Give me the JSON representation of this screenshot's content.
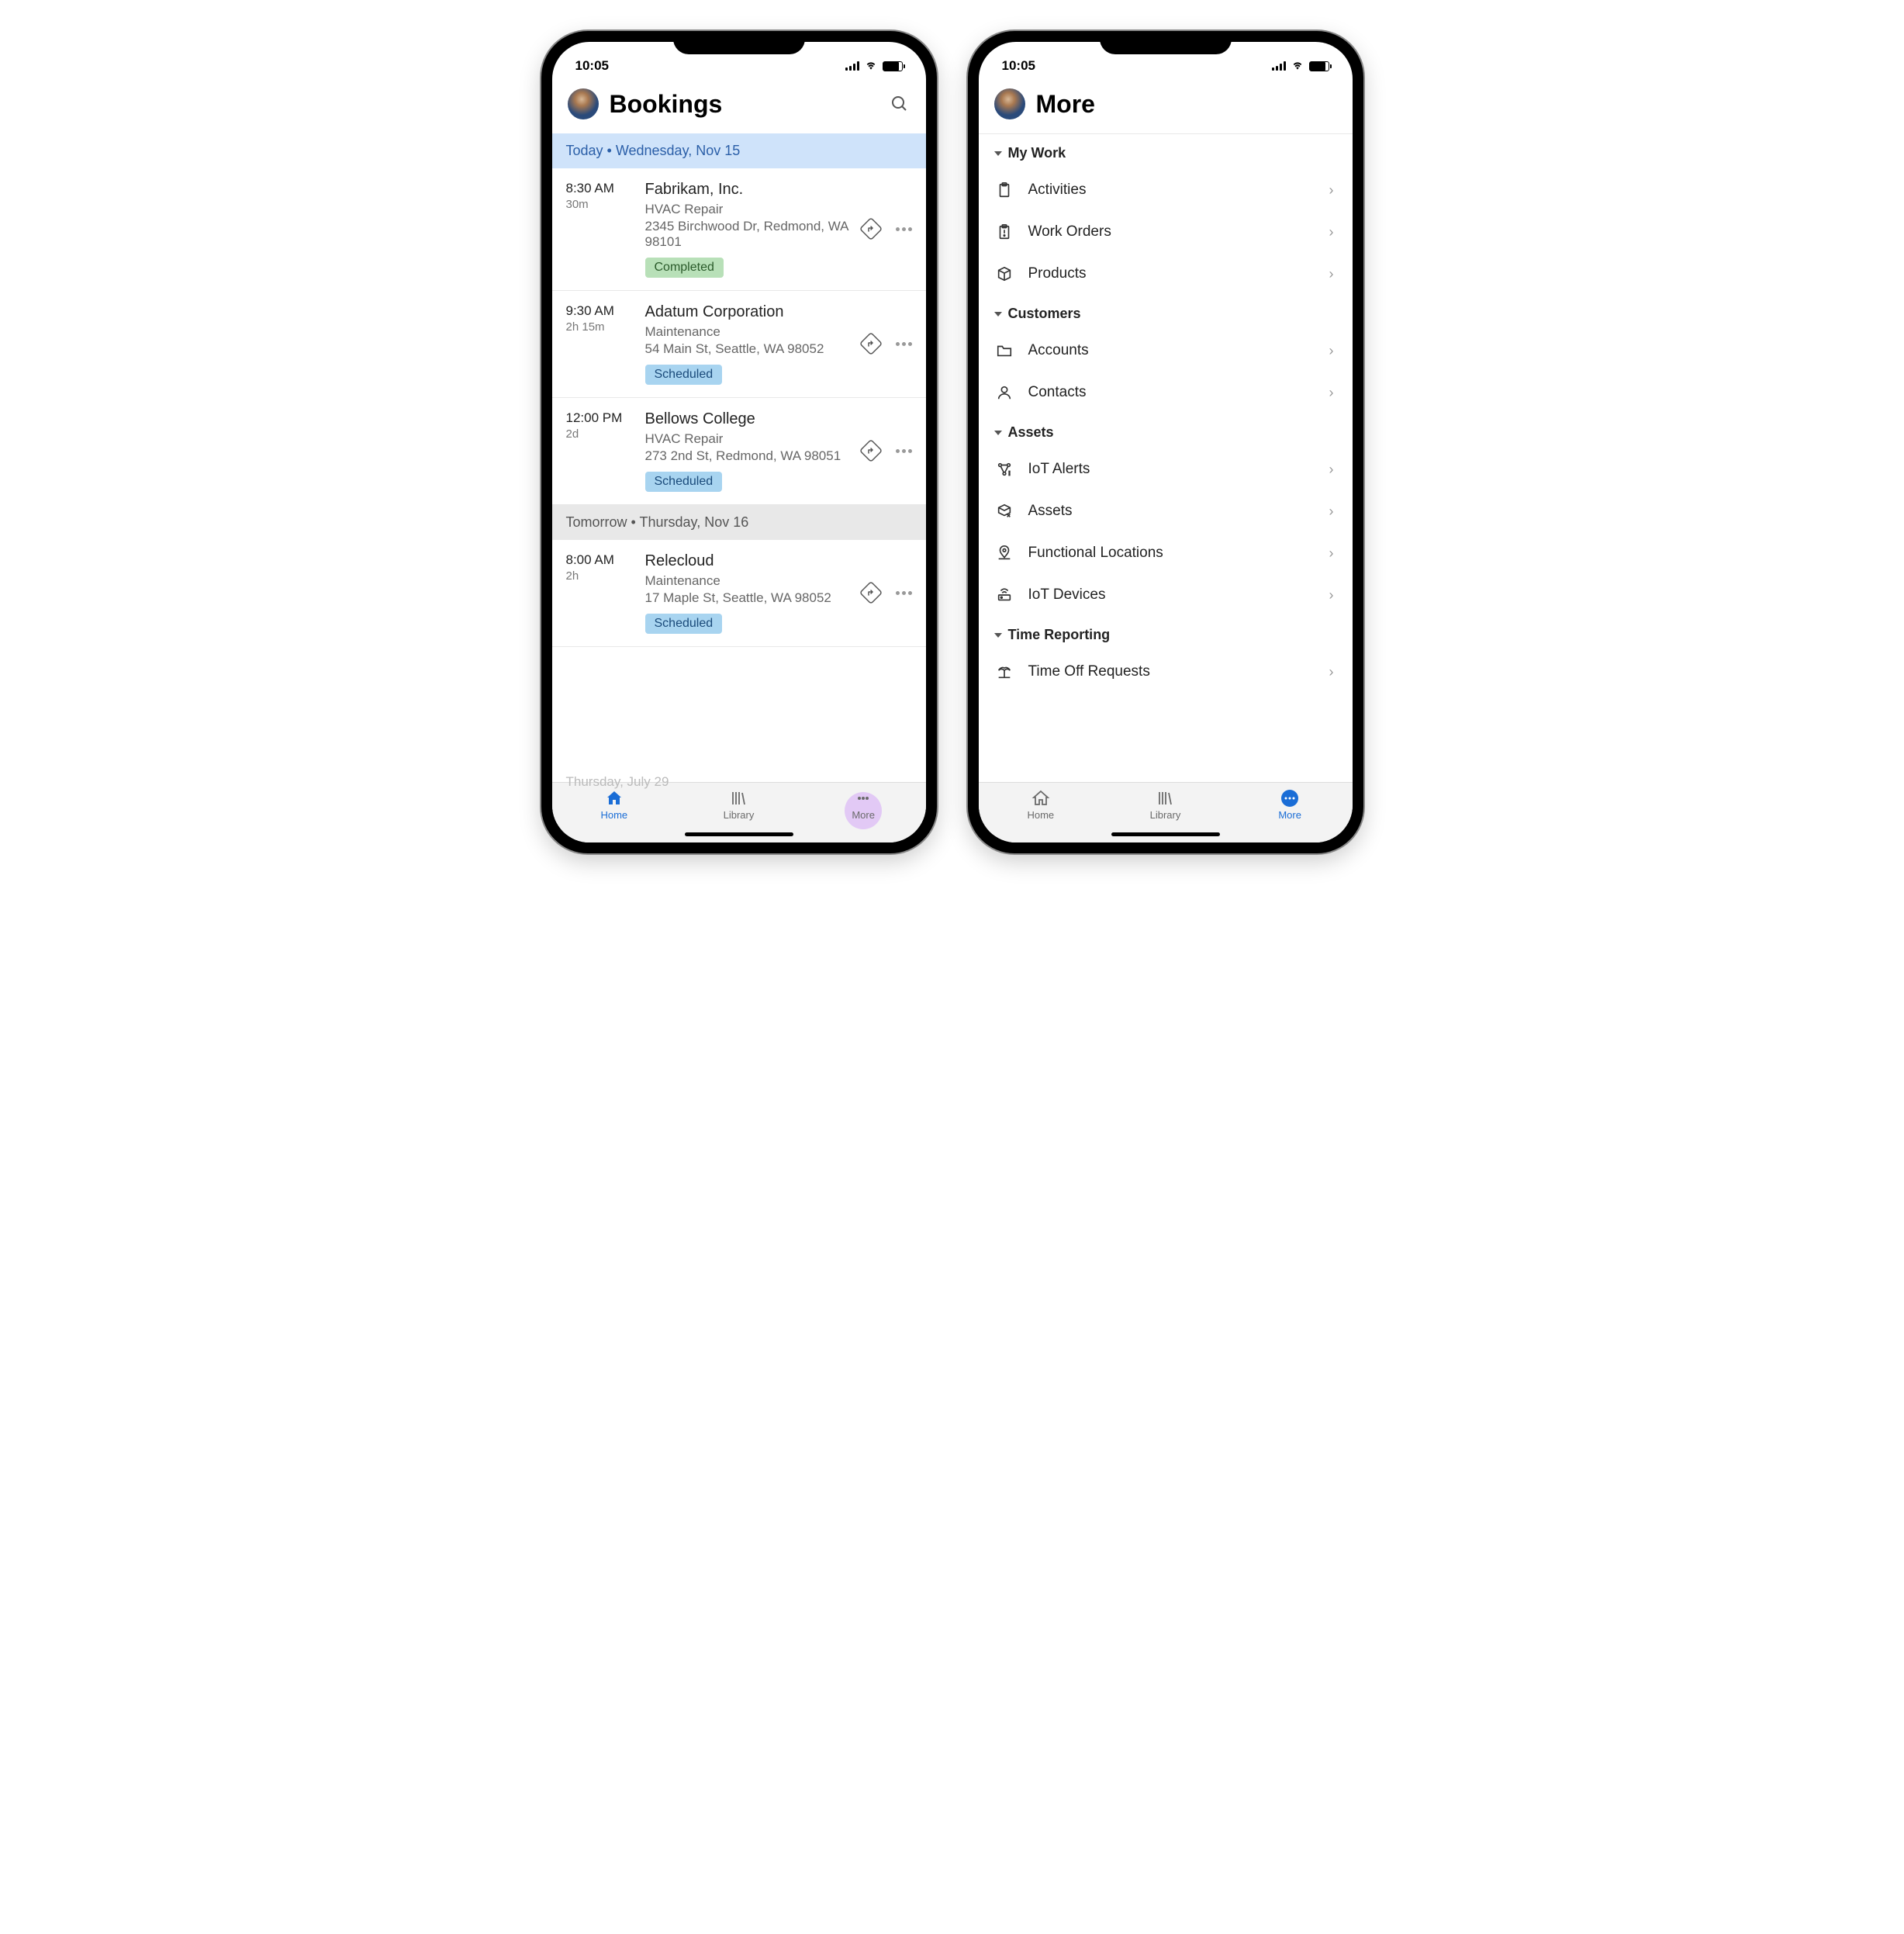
{
  "status_bar": {
    "time": "10:05"
  },
  "left_phone": {
    "title": "Bookings",
    "faded_date": "Thursday, July 29",
    "groups": [
      {
        "label": "Today  •  Wednesday, Nov 15",
        "style": "primary",
        "items": [
          {
            "start": "8:30 AM",
            "duration": "30m",
            "customer": "Fabrikam, Inc.",
            "service": "HVAC Repair",
            "address": "2345 Birchwood Dr, Redmond, WA 98101",
            "status": "Completed",
            "status_class": "completed"
          },
          {
            "start": "9:30 AM",
            "duration": "2h 15m",
            "customer": "Adatum Corporation",
            "service": "Maintenance",
            "address": "54 Main St, Seattle, WA 98052",
            "status": "Scheduled",
            "status_class": "scheduled"
          },
          {
            "start": "12:00 PM",
            "duration": "2d",
            "customer": "Bellows College",
            "service": "HVAC Repair",
            "address": "273 2nd St, Redmond, WA 98051",
            "status": "Scheduled",
            "status_class": "scheduled"
          }
        ]
      },
      {
        "label": "Tomorrow  •  Thursday, Nov 16",
        "style": "secondary",
        "items": [
          {
            "start": "8:00 AM",
            "duration": "2h",
            "customer": "Relecloud",
            "service": "Maintenance",
            "address": "17 Maple St, Seattle, WA 98052",
            "status": "Scheduled",
            "status_class": "scheduled"
          }
        ]
      }
    ],
    "tabs": [
      {
        "key": "home",
        "label": "Home",
        "active": true
      },
      {
        "key": "library",
        "label": "Library",
        "active": false
      },
      {
        "key": "more",
        "label": "More",
        "active": false,
        "halo": true
      }
    ]
  },
  "right_phone": {
    "title": "More",
    "sections": [
      {
        "title": "My Work",
        "items": [
          {
            "icon": "clipboard",
            "label": "Activities"
          },
          {
            "icon": "clipboard-alert",
            "label": "Work Orders"
          },
          {
            "icon": "box",
            "label": "Products"
          }
        ]
      },
      {
        "title": "Customers",
        "items": [
          {
            "icon": "folder",
            "label": "Accounts"
          },
          {
            "icon": "person",
            "label": "Contacts"
          }
        ]
      },
      {
        "title": "Assets",
        "items": [
          {
            "icon": "iot-alert",
            "label": "IoT Alerts"
          },
          {
            "icon": "box-edit",
            "label": "Assets"
          },
          {
            "icon": "location",
            "label": "Functional Locations"
          },
          {
            "icon": "router",
            "label": "IoT Devices"
          }
        ]
      },
      {
        "title": "Time Reporting",
        "items": [
          {
            "icon": "vacation",
            "label": "Time Off Requests"
          }
        ]
      }
    ],
    "tabs": [
      {
        "key": "home",
        "label": "Home",
        "active": false
      },
      {
        "key": "library",
        "label": "Library",
        "active": false
      },
      {
        "key": "more",
        "label": "More",
        "active": true
      }
    ]
  }
}
